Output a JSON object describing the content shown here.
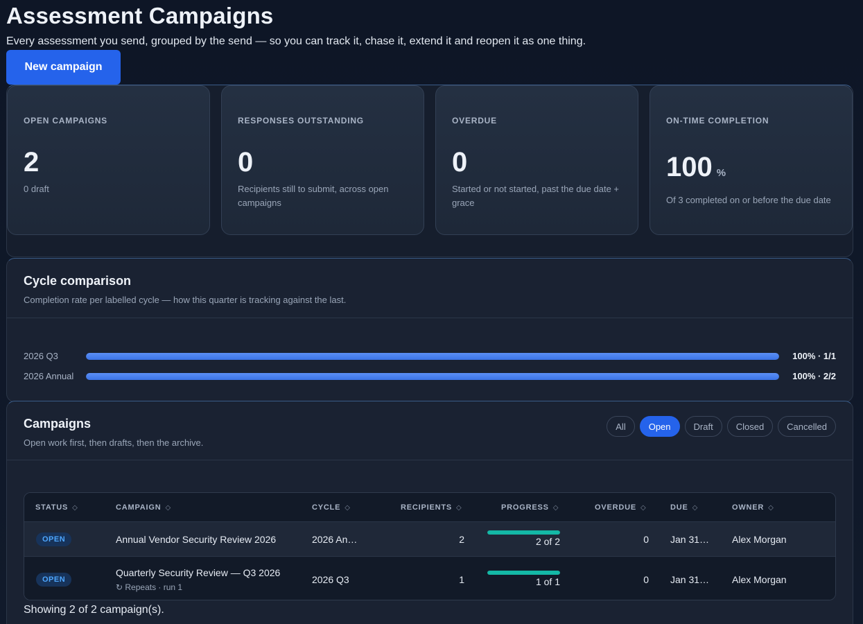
{
  "header": {
    "title": "Assessment Campaigns",
    "subtitle": "Every assessment you send, grouped by the send — so you can track it, chase it, extend it and reopen it as one thing.",
    "new_button": "New campaign"
  },
  "kpis": [
    {
      "label": "OPEN CAMPAIGNS",
      "value": "2",
      "unit": "",
      "sub": "0 draft"
    },
    {
      "label": "RESPONSES OUTSTANDING",
      "value": "0",
      "unit": "",
      "sub": "Recipients still to submit, across open campaigns"
    },
    {
      "label": "OVERDUE",
      "value": "0",
      "unit": "",
      "sub": "Started or not started, past the due date + grace"
    },
    {
      "label": "ON-TIME COMPLETION",
      "value": "100",
      "unit": "%",
      "sub": "Of 3 completed on or before the due date"
    }
  ],
  "cycle": {
    "title": "Cycle comparison",
    "subtitle": "Completion rate per labelled cycle — how this quarter is tracking against the last.",
    "rows": [
      {
        "label": "2026 Q3",
        "rate": 1.0,
        "value": "100% · 1/1"
      },
      {
        "label": "2026 Annual",
        "rate": 1.0,
        "value": "100% · 2/2"
      }
    ]
  },
  "campaigns": {
    "title": "Campaigns",
    "subtitle": "Open work first, then drafts, then the archive.",
    "filters": [
      "All",
      "Open",
      "Draft",
      "Closed",
      "Cancelled"
    ],
    "active_filter": "Open",
    "columns": [
      "STATUS",
      "CAMPAIGN",
      "CYCLE",
      "RECIPIENTS",
      "PROGRESS",
      "OVERDUE",
      "DUE",
      "OWNER"
    ],
    "rows": [
      {
        "status": "OPEN",
        "name": "Annual Vendor Security Review 2026",
        "note": "",
        "cycle": "2026 An…",
        "recipients": "2",
        "progress": 1.0,
        "progress_text": "2 of 2",
        "overdue": "0",
        "due": "Jan 31…",
        "owner": "Alex Morgan"
      },
      {
        "status": "OPEN",
        "name": "Quarterly Security Review — Q3 2026",
        "note": "↻ Repeats · run 1",
        "cycle": "2026 Q3",
        "recipients": "1",
        "progress": 1.0,
        "progress_text": "1 of 1",
        "overdue": "0",
        "due": "Jan 31…",
        "owner": "Alex Morgan"
      }
    ],
    "footer": "Showing 2 of 2 campaign(s)."
  },
  "colors": {
    "accent": "#2563eb",
    "progress": "#14b8a6",
    "badge_text": "#4ea7ff"
  },
  "icons": {
    "sort": "sort-icon",
    "repeat": "repeat-icon"
  }
}
